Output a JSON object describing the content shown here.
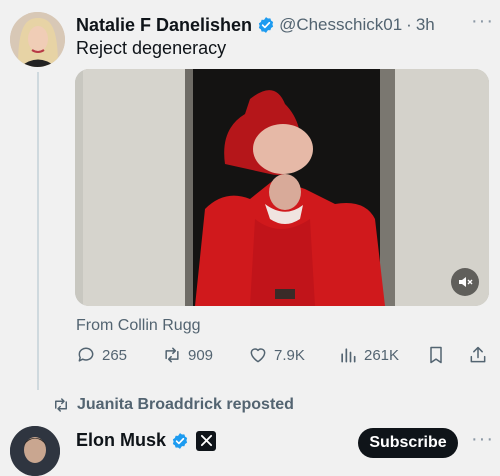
{
  "tweet": {
    "author_name": "Natalie F Danelishen",
    "author_handle": "@Chesschick01",
    "separator": "·",
    "time": "3h",
    "text": "Reject degeneracy",
    "source": "From Collin Rugg",
    "media_icon": "mute-icon",
    "counts": {
      "replies": "265",
      "reposts": "909",
      "likes": "7.9K",
      "views": "261K"
    }
  },
  "repost_notice": {
    "text": "Juanita Broaddrick reposted"
  },
  "next_tweet": {
    "author_name": "Elon Musk",
    "subscribe_label": "Subscribe"
  },
  "colors": {
    "background": "#f1f1f1",
    "verified_blue": "#1d9bf0",
    "text_primary": "#0f1419",
    "text_secondary": "#536471"
  }
}
